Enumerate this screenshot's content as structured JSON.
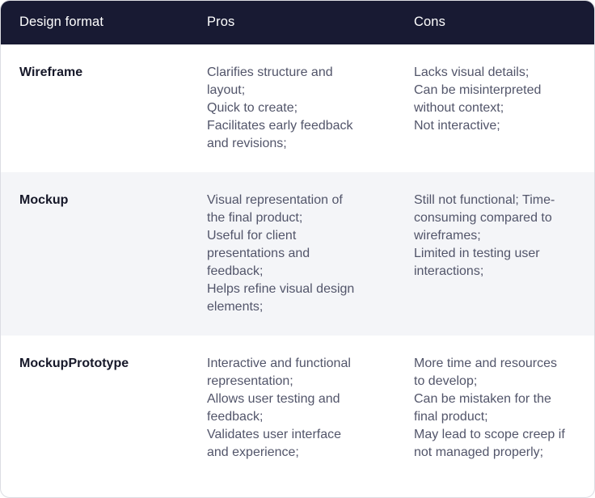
{
  "table": {
    "headers": {
      "format": "Design format",
      "pros": "Pros",
      "cons": "Cons"
    },
    "rows": [
      {
        "format": "Wireframe",
        "pros": [
          "Clarifies structure and layout;",
          "Quick to create;",
          "Facilitates early feedback and revisions;"
        ],
        "cons": [
          "Lacks visual details;",
          "Can be misinterpreted without context;",
          "Not interactive;"
        ]
      },
      {
        "format": "Mockup",
        "pros": [
          "Visual representation of the final product;",
          "Useful for client presentations and feedback;",
          "Helps refine visual design elements;"
        ],
        "cons": [
          "Still not functional; Time-consuming compared to wireframes;",
          "Limited in testing user interactions;"
        ]
      },
      {
        "format": "MockupPrototype",
        "pros": [
          "Interactive and functional representation;",
          "Allows user testing and feedback;",
          "Validates user interface and experience;"
        ],
        "cons": [
          "More time and resources to develop;",
          "Can be mistaken for the final product;",
          "May lead to scope creep if not managed properly;"
        ]
      }
    ]
  }
}
